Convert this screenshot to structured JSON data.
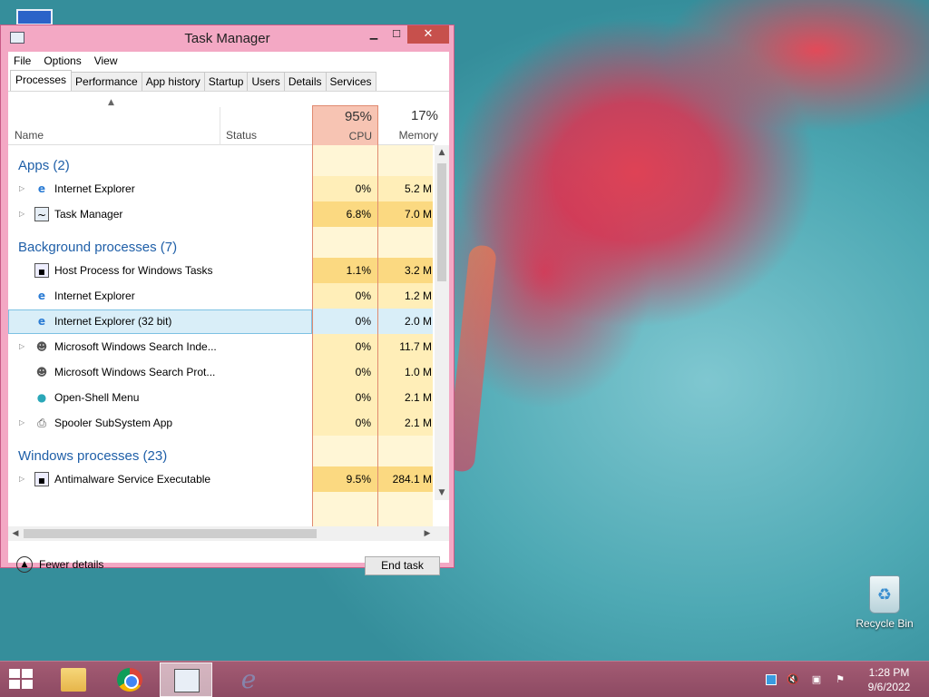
{
  "window": {
    "title": "Task Manager",
    "min_glyph": "▭",
    "max_glyph": "☐",
    "close_glyph": "✕"
  },
  "menu": [
    "File",
    "Options",
    "View"
  ],
  "tabs": [
    "Processes",
    "Performance",
    "App history",
    "Startup",
    "Users",
    "Details",
    "Services"
  ],
  "active_tab": "Processes",
  "columns": {
    "name": "Name",
    "status": "Status",
    "cpu_pct": "95%",
    "cpu": "CPU",
    "mem_pct": "17%",
    "mem": "Memory"
  },
  "groups": {
    "apps": "Apps (2)",
    "background": "Background processes (7)",
    "windows": "Windows processes (23)"
  },
  "rows": {
    "r1": {
      "name": "Internet Explorer",
      "cpu": "0%",
      "mem": "5.2 M",
      "icon": "ie-icon"
    },
    "r2": {
      "name": "Task Manager",
      "cpu": "6.8%",
      "mem": "7.0 M",
      "icon": "task-manager-icon"
    },
    "r3": {
      "name": "Host Process for Windows Tasks",
      "cpu": "1.1%",
      "mem": "3.2 M",
      "icon": "window-icon"
    },
    "r4": {
      "name": "Internet Explorer",
      "cpu": "0%",
      "mem": "1.2 M",
      "icon": "ie-icon"
    },
    "r5": {
      "name": "Internet Explorer (32 bit)",
      "cpu": "0%",
      "mem": "2.0 M",
      "icon": "ie-icon"
    },
    "r6": {
      "name": "Microsoft Windows Search Inde...",
      "cpu": "0%",
      "mem": "11.7 M",
      "icon": "user-icon"
    },
    "r7": {
      "name": "Microsoft Windows Search Prot...",
      "cpu": "0%",
      "mem": "1.0 M",
      "icon": "user-icon"
    },
    "r8": {
      "name": "Open-Shell Menu",
      "cpu": "0%",
      "mem": "2.1 M",
      "icon": "shell-icon"
    },
    "r9": {
      "name": "Spooler SubSystem App",
      "cpu": "0%",
      "mem": "2.1 M",
      "icon": "printer-icon"
    },
    "r10": {
      "name": "Antimalware Service Executable",
      "cpu": "9.5%",
      "mem": "284.1 M",
      "icon": "window-icon"
    }
  },
  "footer": {
    "fewer_details": "Fewer details",
    "end_task": "End task"
  },
  "desktop": {
    "recycle_bin": "Recycle Bin"
  },
  "taskbar": {
    "time": "1:28 PM",
    "date": "9/6/2022"
  },
  "colors": {
    "window_frame": "#f3a8c4",
    "close_button": "#c7504c",
    "cpu_highlight": "#f7c4b3",
    "group_label": "#1f5fa8",
    "taskbar": "#8d4a63"
  }
}
